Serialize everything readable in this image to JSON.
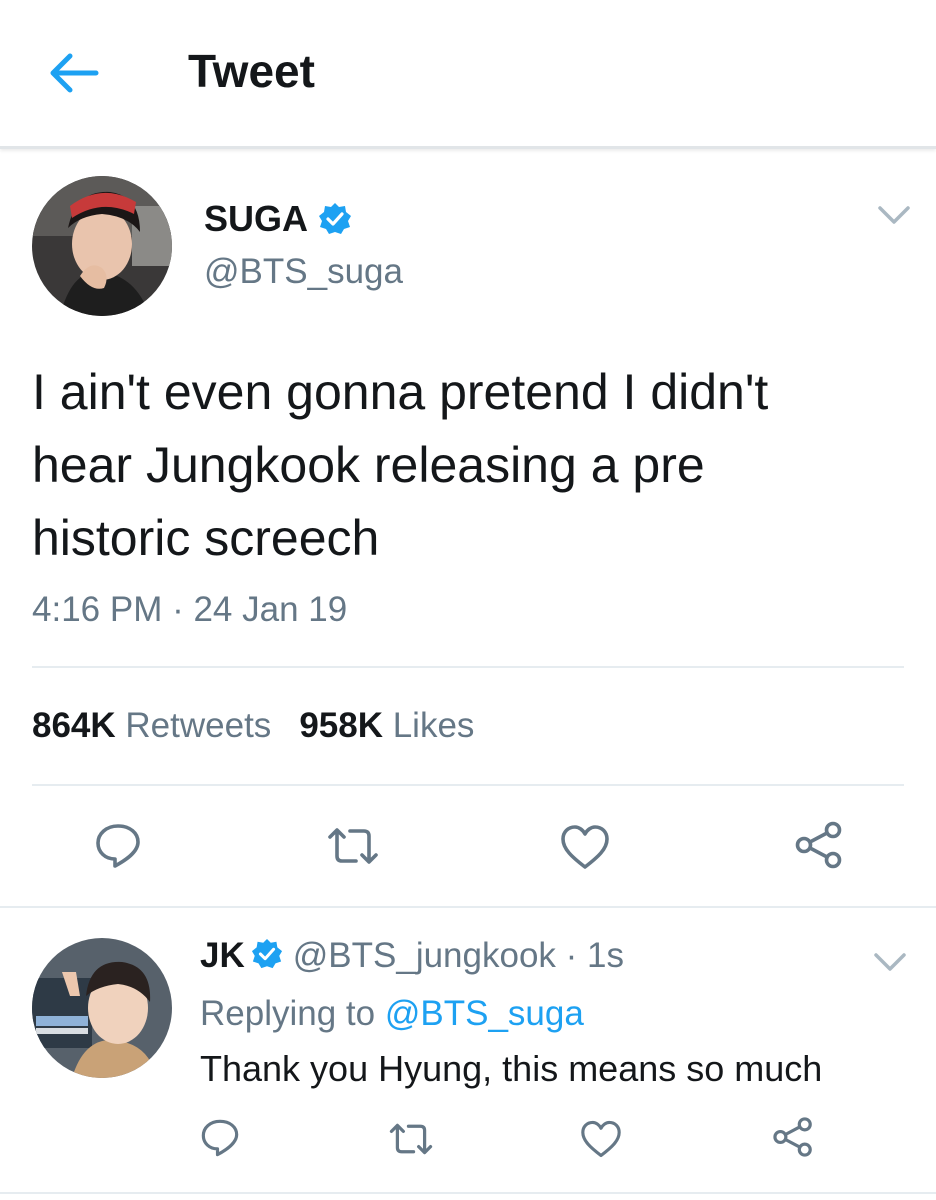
{
  "header": {
    "title": "Tweet",
    "back_icon": "arrow-left-icon"
  },
  "colors": {
    "accent": "#1da1f2",
    "text": "#14171a",
    "muted": "#657786",
    "divider": "#e6ecf0"
  },
  "tweet": {
    "display_name": "SUGA",
    "handle": "@BTS_suga",
    "verified": true,
    "text": "I ain't even gonna pretend I didn't\nhear Jungkook releasing a pre\nhistoric screech",
    "timestamp": "4:16 PM · 24 Jan 19",
    "stats": {
      "retweets_count": "864K",
      "retweets_label": "Retweets",
      "likes_count": "958K",
      "likes_label": "Likes"
    },
    "actions": [
      "reply-icon",
      "retweet-icon",
      "like-icon",
      "share-icon"
    ]
  },
  "reply": {
    "display_name": "JK",
    "handle": "@BTS_jungkook",
    "time": "· 1s",
    "verified": true,
    "replying_prefix": "Replying to",
    "replying_to": "@BTS_suga",
    "text": "Thank you Hyung, this means so much",
    "actions": [
      "reply-icon",
      "retweet-icon",
      "like-icon",
      "share-icon"
    ]
  }
}
